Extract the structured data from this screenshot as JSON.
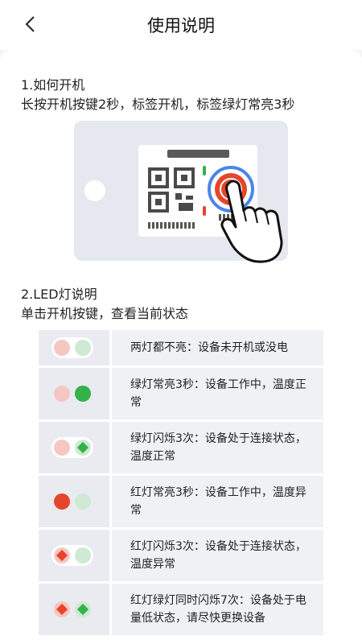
{
  "header": {
    "title": "使用说明",
    "back_icon": "chevron-left-icon"
  },
  "section1": {
    "title": "1.如何开机",
    "subtitle": "长按开机按键2秒，标签开机，标签绿灯常亮3秒"
  },
  "section2": {
    "title": "2.LED灯说明",
    "subtitle": "单击开机按键，查看当前状态"
  },
  "colors": {
    "red_on": "#e7452b",
    "red_off": "#f6c7c2",
    "green_on": "#33b24a",
    "green_off": "#cfe9d3",
    "accent_blue": "#4a86e8"
  },
  "led_table": [
    {
      "red": "off",
      "green": "off",
      "description": "两灯都不亮：设备未开机或没电"
    },
    {
      "red": "off",
      "green": "on",
      "description": "绿灯常亮3秒：设备工作中，温度正常"
    },
    {
      "red": "off",
      "green": "blink",
      "description": "绿灯闪烁3次：设备处于连接状态，温度正常"
    },
    {
      "red": "on",
      "green": "off",
      "description": "红灯常亮3秒：设备工作中，温度异常"
    },
    {
      "red": "blink",
      "green": "off",
      "description": "红灯闪烁3次：设备处于连接状态，温度异常"
    },
    {
      "red": "blink",
      "green": "blink",
      "description": "红灯绿灯同时闪烁7次：设备处于电量低状态，请尽快更换设备"
    }
  ]
}
